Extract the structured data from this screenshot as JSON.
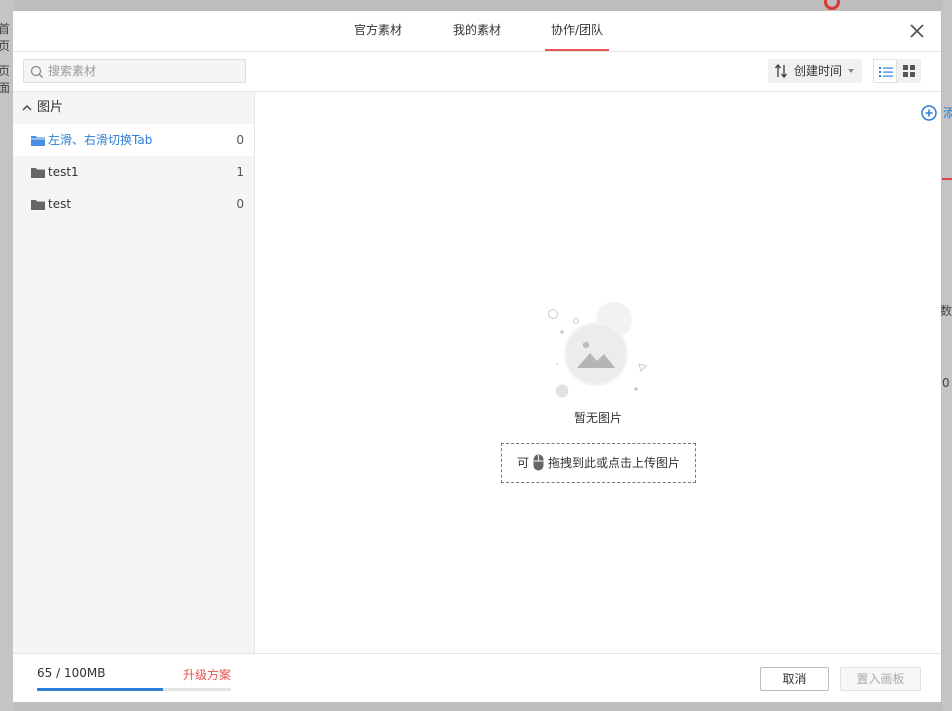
{
  "background": {
    "left_fragments": [
      "首页",
      "页面"
    ],
    "right_fragments": [
      "数",
      "0"
    ]
  },
  "dialog": {
    "tabs": [
      {
        "label": "官方素材",
        "active": false
      },
      {
        "label": "我的素材",
        "active": false
      },
      {
        "label": "协作/团队",
        "active": true
      }
    ],
    "close_icon": "close-icon"
  },
  "toolbar": {
    "search": {
      "placeholder": "搜索素材",
      "value": ""
    },
    "sort": {
      "label": "创建时间",
      "icon": "sort-icon"
    },
    "view_modes": [
      "list-view",
      "grid-view"
    ],
    "active_view": "list-view"
  },
  "sidebar": {
    "group": {
      "label": "图片",
      "expanded": true
    },
    "folders": [
      {
        "name": "左滑、右滑切换Tab",
        "count": "0",
        "selected": true
      },
      {
        "name": "test1",
        "count": "1",
        "selected": false
      },
      {
        "name": "test",
        "count": "0",
        "selected": false
      }
    ]
  },
  "main": {
    "add_label": "添加图片",
    "empty_text": "暂无图片",
    "upload_prefix": "可",
    "upload_hint": "拖拽到此或点击上传图片"
  },
  "footer": {
    "storage_text": "65 / 100MB",
    "storage_used_fraction": 0.65,
    "upgrade_label": "升级方案",
    "cancel_label": "取消",
    "place_label": "置入画板"
  },
  "colors": {
    "accent_blue": "#2b7fd6",
    "active_tab_underline": "#e8554e",
    "upgrade_red": "#e8554e"
  }
}
